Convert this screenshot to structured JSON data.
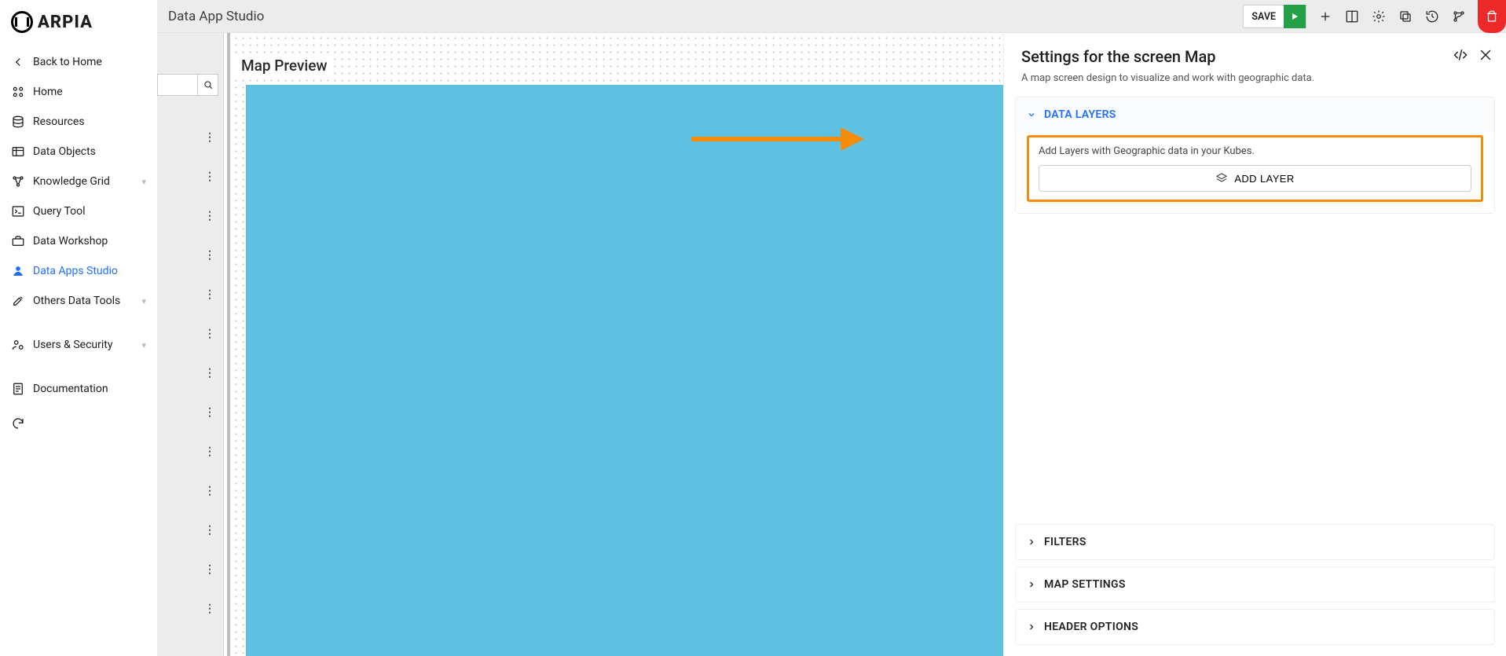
{
  "app": {
    "logo_text": "ARPIA"
  },
  "topbar": {
    "title": "Data App Studio",
    "save_label": "SAVE"
  },
  "sidebar": {
    "back_label": "Back to Home",
    "items": [
      {
        "label": "Home"
      },
      {
        "label": "Resources"
      },
      {
        "label": "Data Objects"
      },
      {
        "label": "Knowledge Grid",
        "expandable": true
      },
      {
        "label": "Query Tool"
      },
      {
        "label": "Data Workshop"
      },
      {
        "label": "Data Apps Studio",
        "active": true
      },
      {
        "label": "Others Data Tools",
        "expandable": true
      },
      {
        "label": "Users & Security",
        "expandable": true
      },
      {
        "label": "Documentation"
      }
    ]
  },
  "canvas": {
    "preview_title": "Map Preview"
  },
  "settings": {
    "title": "Settings for the screen Map",
    "subtitle": "A map screen design to visualize and work with geographic data.",
    "sections": {
      "data_layers": {
        "title": "DATA LAYERS",
        "hint": "Add Layers with Geographic data in your Kubes.",
        "add_button": "ADD LAYER"
      },
      "filters": {
        "title": "FILTERS"
      },
      "map_settings": {
        "title": "MAP SETTINGS"
      },
      "header_options": {
        "title": "HEADER OPTIONS"
      }
    }
  },
  "search": {
    "placeholder": ""
  }
}
